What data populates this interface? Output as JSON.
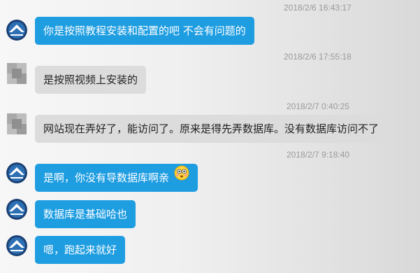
{
  "conversation": {
    "messages": [
      {
        "timestamp": "2018/2/6 16:43:17",
        "sender": "self",
        "text": "你是按照教程安装和配置的吧 不会有问题的"
      },
      {
        "timestamp": "2018/2/6 17:55:18",
        "sender": "other",
        "text": "是按照视频上安装的"
      },
      {
        "timestamp": "2018/2/7 0:40:25",
        "sender": "other",
        "text": "网站现在弄好了，能访问了。原来是得先弄数据库。没有数据库访问不了"
      },
      {
        "timestamp": "2018/2/7 9:18:40",
        "sender": "self",
        "text": "是啊，你没有导数据库啊亲",
        "emoji": "flushed-face-icon"
      },
      {
        "sender": "self",
        "text": "数据库是基础哈也"
      },
      {
        "sender": "self",
        "text": "嗯，跑起来就好"
      }
    ]
  },
  "colors": {
    "self_bubble": "#1e9de1",
    "other_bubble": "#dcdcdc",
    "timestamp": "#9a9a9a"
  }
}
